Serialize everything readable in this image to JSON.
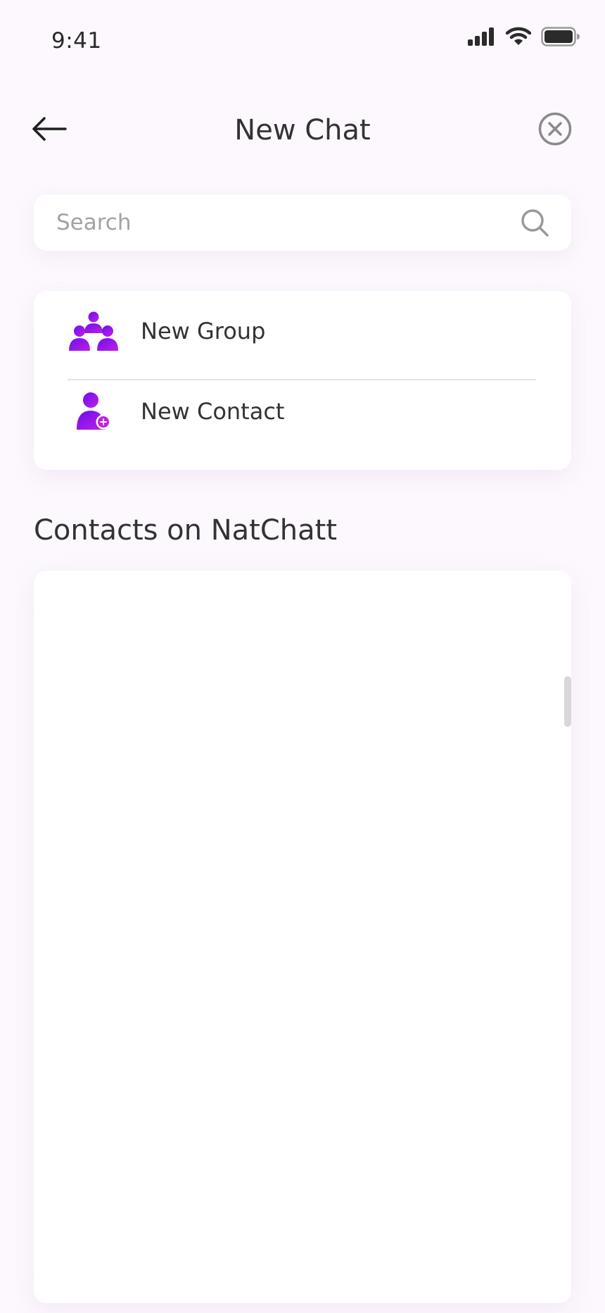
{
  "status_bar": {
    "time": "9:41",
    "icons": [
      "cellular-signal-icon",
      "wifi-icon",
      "battery-icon"
    ]
  },
  "header": {
    "title": "New Chat",
    "back_icon": "arrow-left-icon",
    "close_icon": "close-circle-icon"
  },
  "search": {
    "placeholder": "Search",
    "value": "",
    "icon": "search-icon"
  },
  "actions": [
    {
      "label": "New Group",
      "icon": "group-icon"
    },
    {
      "label": "New Contact",
      "icon": "add-contact-icon"
    }
  ],
  "contacts_section": {
    "title": "Contacts on NatChatt",
    "items": []
  },
  "colors": {
    "background": "#fcf8fd",
    "accent_gradient_start": "#6a0ff0",
    "accent_gradient_end": "#c21fe0",
    "text": "#333333",
    "placeholder": "#a2a2a2"
  }
}
